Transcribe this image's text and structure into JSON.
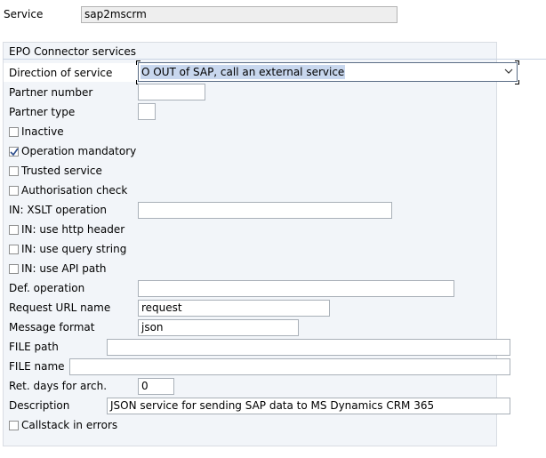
{
  "header": {
    "service_label": "Service",
    "service_value": "sap2mscrm"
  },
  "group": {
    "title": "EPO Connector services"
  },
  "form": {
    "direction_label": "Direction of service",
    "direction_value": "O OUT of SAP, call an external service",
    "partner_number_label": "Partner number",
    "partner_number_value": "",
    "partner_type_label": "Partner type",
    "partner_type_value": "",
    "inactive_label": "Inactive",
    "inactive_checked": false,
    "operation_mandatory_label": "Operation mandatory",
    "operation_mandatory_checked": true,
    "trusted_service_label": "Trusted service",
    "trusted_service_checked": false,
    "authorisation_check_label": "Authorisation check",
    "authorisation_check_checked": false,
    "xslt_label": "IN: XSLT operation",
    "xslt_value": "",
    "http_header_label": "IN: use http header",
    "http_header_checked": false,
    "query_string_label": "IN: use query string",
    "query_string_checked": false,
    "api_path_label": "IN: use API path",
    "api_path_checked": false,
    "def_operation_label": "Def. operation",
    "def_operation_value": "",
    "request_url_label": "Request URL name",
    "request_url_value": "request",
    "message_format_label": "Message format",
    "message_format_value": "json",
    "file_path_label": "FILE path",
    "file_path_value": "",
    "file_name_label": "FILE name",
    "file_name_value": "",
    "ret_days_label": "Ret. days for arch.",
    "ret_days_value": "0",
    "description_label": "Description",
    "description_value": "JSON service for sending SAP data to MS Dynamics CRM 365",
    "callstack_label": "Callstack in errors",
    "callstack_checked": false
  },
  "icons": {
    "dropdown": "chevron-down-icon",
    "check": "checkmark-icon"
  },
  "colors": {
    "group_background": "#f2f5f9",
    "readonly_field": "#eeeeee",
    "selection_highlight": "#c8d7ee"
  }
}
